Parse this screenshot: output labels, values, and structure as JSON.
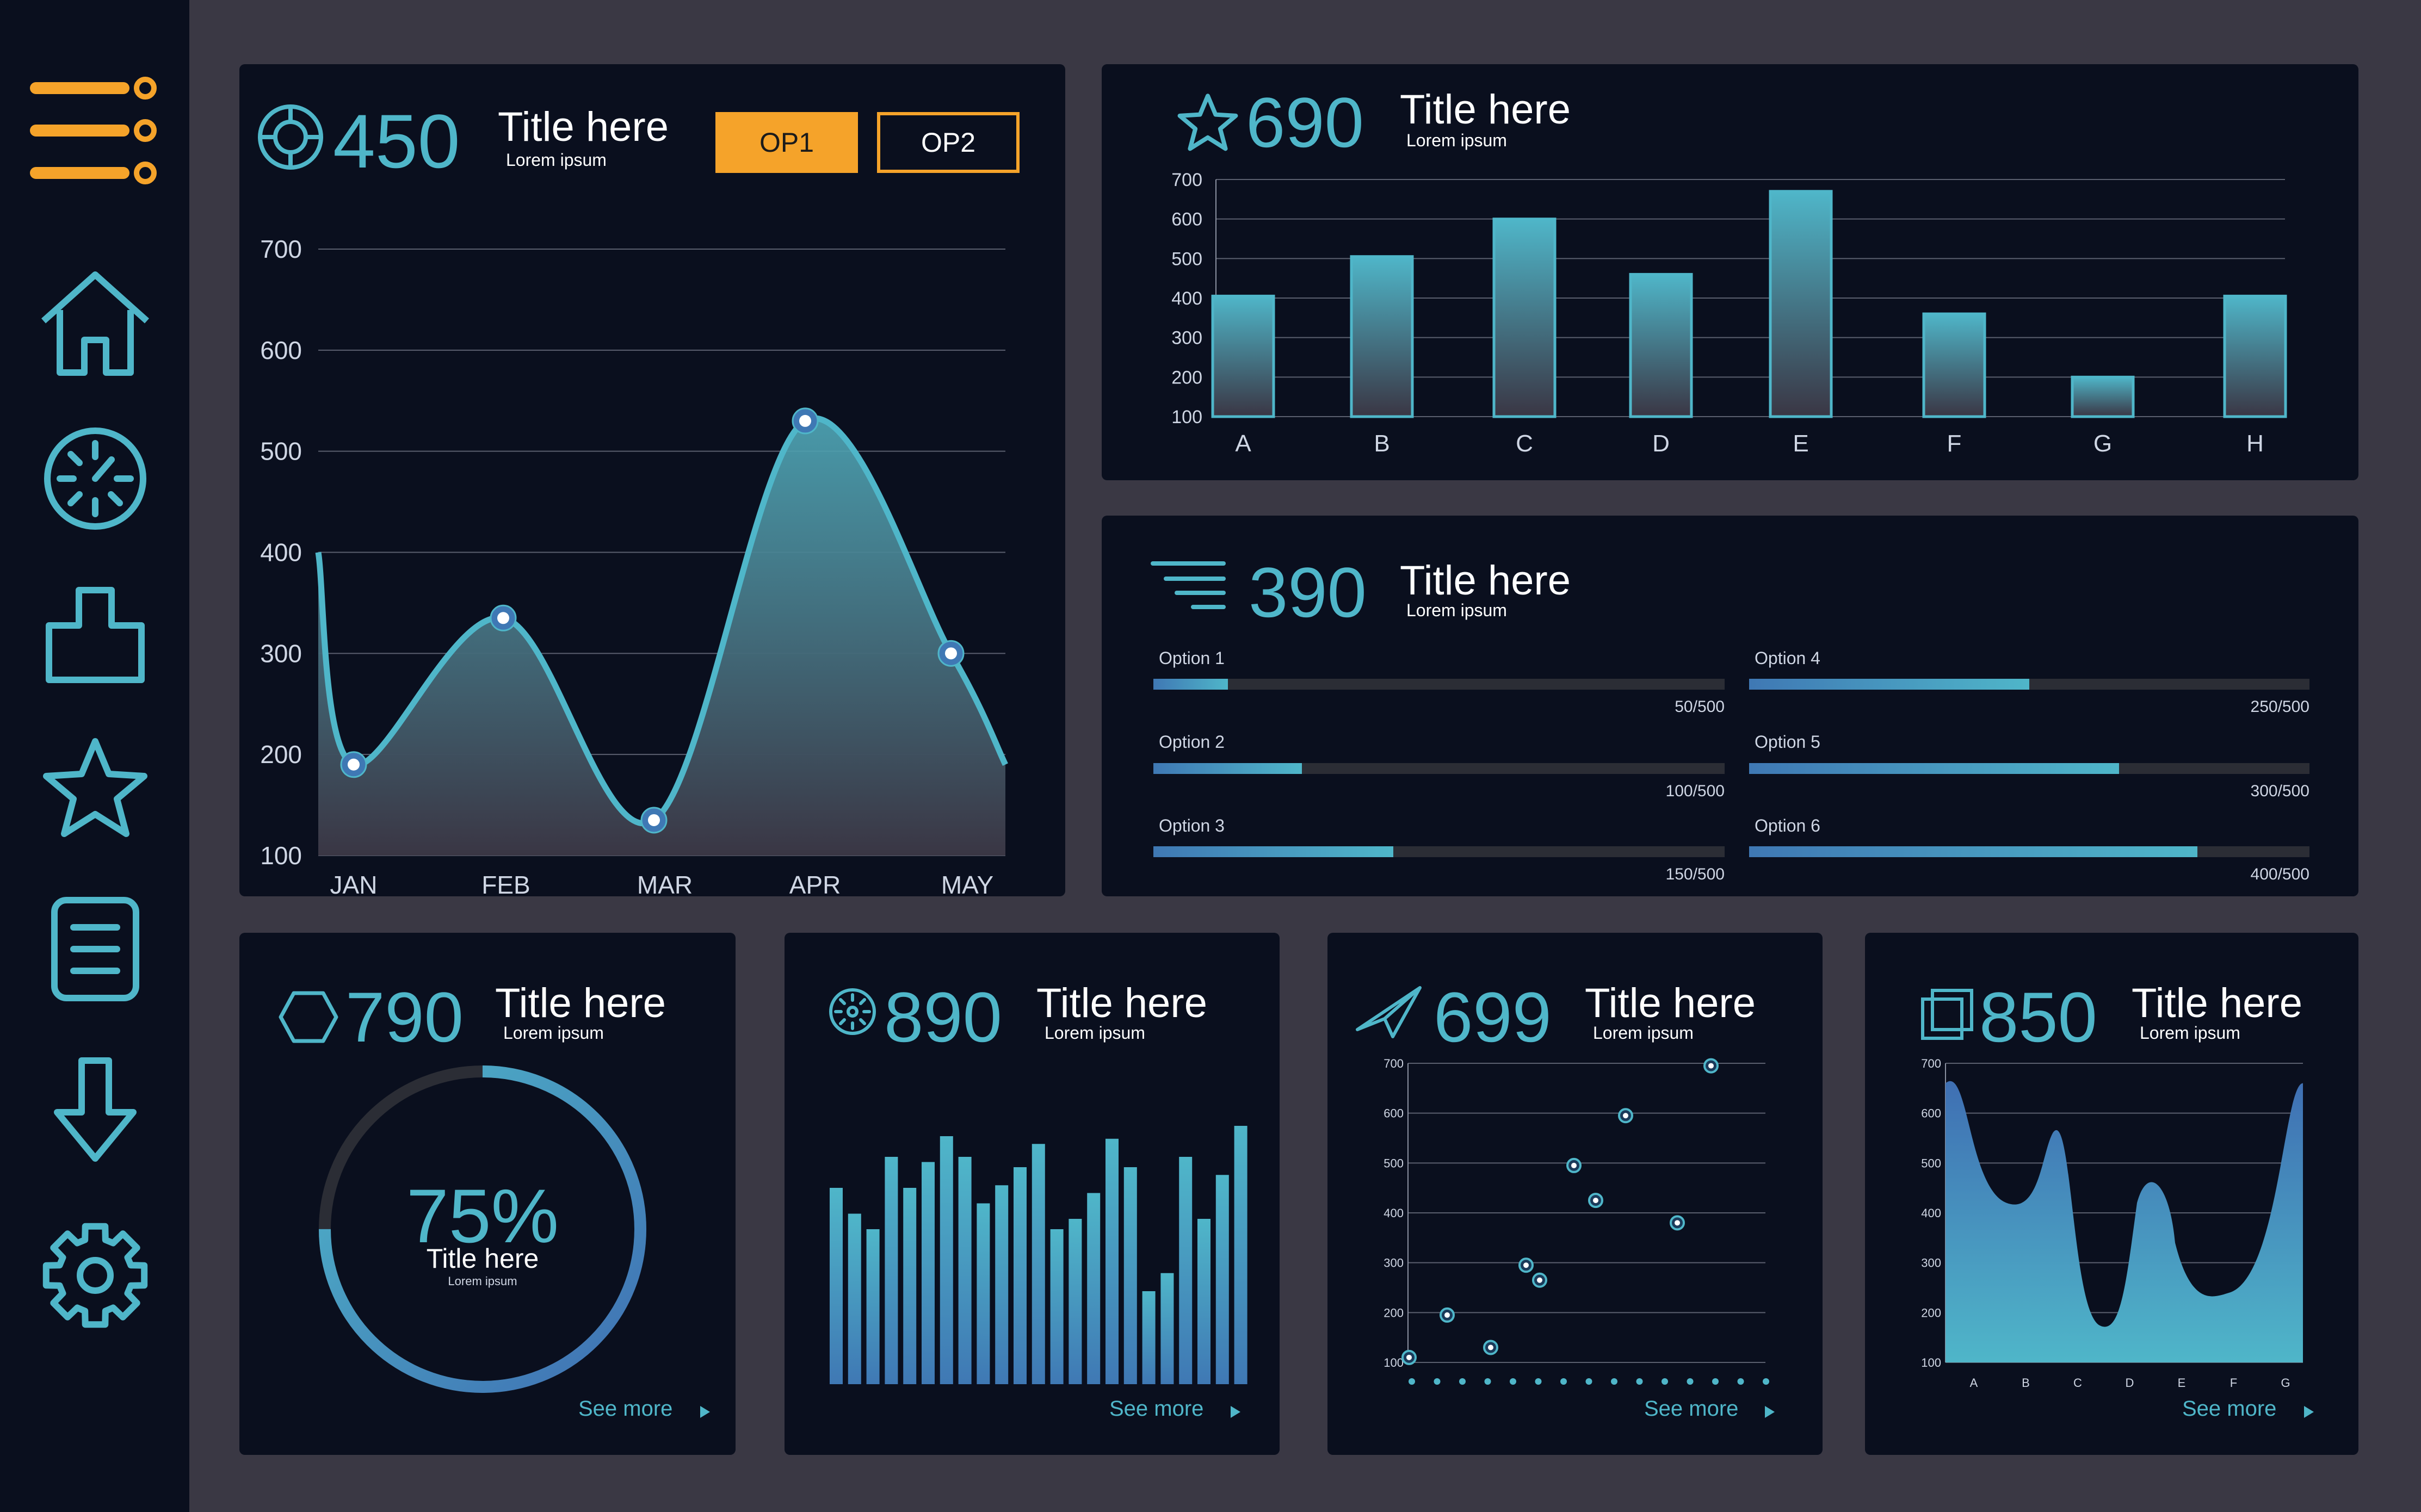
{
  "colors": {
    "accent": "#4fb6c9",
    "accent_dark": "#3f6fb3",
    "orange": "#f5a32a",
    "panel": "#0a0f1e",
    "background": "#3a3844"
  },
  "sidebar": {
    "menu_icon": "hamburger-menu-icon",
    "items": [
      {
        "name": "home",
        "icon": "home-icon"
      },
      {
        "name": "dashboard",
        "icon": "speedometer-icon"
      },
      {
        "name": "modules",
        "icon": "puzzle-icon"
      },
      {
        "name": "favorites",
        "icon": "star-icon"
      },
      {
        "name": "documents",
        "icon": "document-icon"
      },
      {
        "name": "download",
        "icon": "download-arrow-icon"
      },
      {
        "name": "settings",
        "icon": "gear-icon"
      }
    ]
  },
  "panels": {
    "line": {
      "icon": "target-icon",
      "number": "450",
      "title": "Title here",
      "subtitle": "Lorem ipsum",
      "op1": "OP1",
      "op2": "OP2"
    },
    "bars": {
      "icon": "star-outline-icon",
      "number": "690",
      "title": "Title here",
      "subtitle": "Lorem ipsum"
    },
    "progress": {
      "icon": "lines-icon",
      "number": "390",
      "title": "Title here",
      "subtitle": "Lorem ipsum",
      "items": [
        {
          "label": "Option 1",
          "value": "50/500",
          "fraction": 0.13
        },
        {
          "label": "Option 4",
          "value": "250/500",
          "fraction": 0.5
        },
        {
          "label": "Option 2",
          "value": "100/500",
          "fraction": 0.26
        },
        {
          "label": "Option 5",
          "value": "300/500",
          "fraction": 0.66
        },
        {
          "label": "Option 3",
          "value": "150/500",
          "fraction": 0.42
        },
        {
          "label": "Option 6",
          "value": "400/500",
          "fraction": 0.8
        }
      ]
    },
    "donut": {
      "icon": "hexagon-icon",
      "number": "790",
      "title": "Title here",
      "subtitle": "Lorem ipsum",
      "percent": "75%",
      "percent_value": 75,
      "inner_title": "Title here",
      "inner_sub": "Lorem ipsum",
      "see_more": "See more"
    },
    "spark": {
      "icon": "sun-dial-icon",
      "number": "890",
      "title": "Title here",
      "subtitle": "Lorem ipsum",
      "see_more": "See more"
    },
    "scatter": {
      "icon": "paper-plane-icon",
      "number": "699",
      "title": "Title here",
      "subtitle": "Lorem ipsum",
      "see_more": "See more"
    },
    "area": {
      "icon": "squares-icon",
      "number": "850",
      "title": "Title here",
      "subtitle": "Lorem ipsum",
      "see_more": "See more"
    }
  },
  "chart_data": [
    {
      "type": "area",
      "categories": [
        "JAN",
        "FEB",
        "MAR",
        "APR",
        "MAY"
      ],
      "values": [
        190,
        335,
        135,
        530,
        300
      ],
      "yticks": [
        100,
        200,
        300,
        400,
        500,
        600,
        700
      ],
      "ylim": [
        100,
        700
      ],
      "grid": true
    },
    {
      "type": "bar",
      "categories": [
        "A",
        "B",
        "C",
        "D",
        "E",
        "F",
        "G",
        "H"
      ],
      "values": [
        405,
        505,
        600,
        460,
        670,
        360,
        200,
        405
      ],
      "yticks": [
        100,
        200,
        300,
        400,
        500,
        600,
        700
      ],
      "ylim": [
        100,
        700
      ],
      "grid": true
    },
    {
      "type": "bar",
      "values": [
        0.76,
        0.66,
        0.6,
        0.88,
        0.76,
        0.86,
        0.96,
        0.88,
        0.7,
        0.77,
        0.84,
        0.93,
        0.6,
        0.64,
        0.74,
        0.95,
        0.84,
        0.36,
        0.43,
        0.88,
        0.64,
        0.81,
        1.0
      ],
      "grid": false
    },
    {
      "type": "scatter",
      "x": [
        1,
        2,
        3,
        4,
        5,
        6,
        7,
        8,
        9,
        10
      ],
      "values": [
        110,
        195,
        130,
        295,
        265,
        495,
        425,
        595,
        380,
        695
      ],
      "yticks": [
        100,
        200,
        300,
        400,
        500,
        600,
        700
      ],
      "ylim": [
        100,
        700
      ],
      "grid": true
    },
    {
      "type": "area",
      "categories": [
        "A",
        "B",
        "C",
        "D",
        "E",
        "F",
        "G"
      ],
      "yticks": [
        100,
        200,
        300,
        400,
        500,
        600,
        700
      ],
      "ylim": [
        100,
        700
      ],
      "grid": true
    }
  ]
}
